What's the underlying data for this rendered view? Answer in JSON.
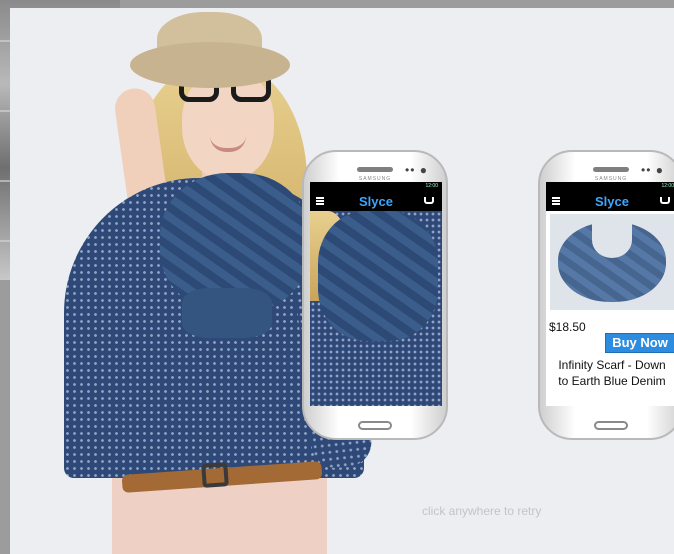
{
  "app": {
    "name": "Slyce"
  },
  "phone_left": {
    "status_text": "12:00"
  },
  "phone_right": {
    "status_text": "12:00",
    "product": {
      "price": "$18.50",
      "buy_label": "Buy Now",
      "title": "Infinity Scarf - Down to Earth Blue Denim"
    }
  },
  "phone_brand": "SAMSUNG",
  "retry_hint": "click anywhere to retry",
  "colors": {
    "accent": "#3da6ff",
    "button": "#2e8ce0",
    "panel": "#eceef1"
  }
}
